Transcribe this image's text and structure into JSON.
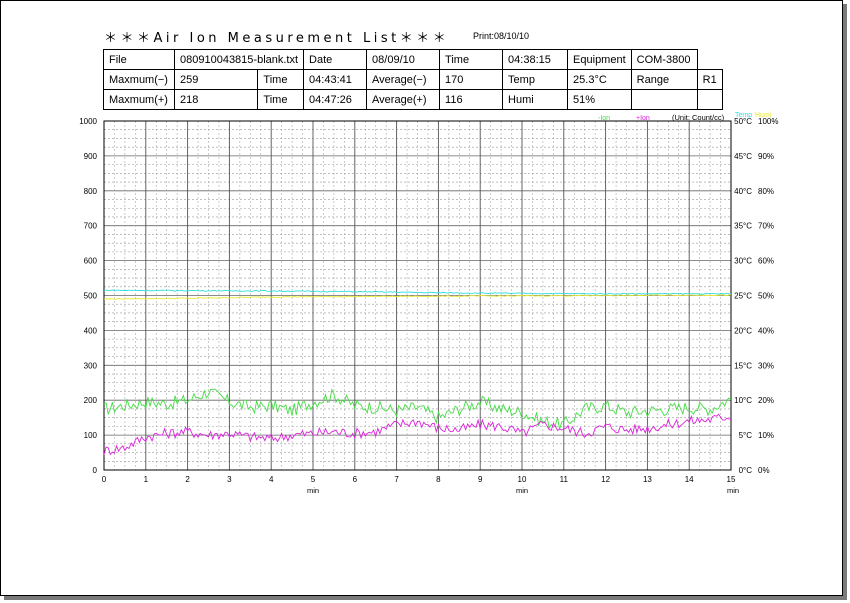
{
  "header": {
    "title": "＊＊＊Air Ion Measurement List＊＊＊",
    "print": "Print:08/10/10"
  },
  "info_table": [
    [
      "File",
      "080910043815-blank.txt",
      "Date",
      "08/09/10",
      "Time",
      "04:38:15",
      "Equipment",
      "COM-3800"
    ],
    [
      "Maxmum(−)",
      "259",
      "Time",
      "04:43:41",
      "Average(−)",
      "170",
      "Temp",
      "25.3°C",
      "Range",
      "R1"
    ],
    [
      "Maxmum(+)",
      "218",
      "Time",
      "04:47:26",
      "Average(+)",
      "116",
      "Humi",
      "51%"
    ]
  ],
  "chart_data": {
    "type": "line",
    "unit_label": "(Unit: Count/cc)",
    "legend": {
      "neg_ion": "-Ion",
      "pos_ion": "+Ion",
      "temp": "Temp",
      "humi": "Humi"
    },
    "x_ticks": [
      "0",
      "1",
      "2",
      "3",
      "4",
      "5",
      "6",
      "7",
      "8",
      "9",
      "10",
      "11",
      "12",
      "13",
      "14",
      "15"
    ],
    "x_unit_labels": [
      "min",
      "min",
      "min"
    ],
    "y_left_ticks": [
      "0",
      "100",
      "200",
      "300",
      "400",
      "500",
      "600",
      "700",
      "800",
      "900",
      "1000"
    ],
    "y_right_temp_ticks": [
      "0°C",
      "5°C",
      "10°C",
      "15°C",
      "20°C",
      "25°C",
      "30°C",
      "35°C",
      "40°C",
      "45°C",
      "50°C"
    ],
    "y_right_humi_ticks": [
      "0%",
      "10%",
      "20%",
      "30%",
      "40%",
      "50%",
      "60%",
      "70%",
      "80%",
      "90%",
      "100%"
    ],
    "xlim": [
      0,
      15
    ],
    "ylim": [
      0,
      1000
    ],
    "colors": {
      "neg_ion": "#44dd44",
      "pos_ion": "#dd22dd",
      "temp": "#e8e830",
      "humi": "#33dddd"
    },
    "series": [
      {
        "name": "-Ion",
        "x": [
          0,
          0.5,
          1,
          1.5,
          2,
          2.5,
          3,
          3.5,
          4,
          4.5,
          5,
          5.5,
          6,
          6.5,
          7,
          7.5,
          8,
          8.5,
          9,
          9.5,
          10,
          10.5,
          11,
          11.5,
          12,
          12.5,
          13,
          13.5,
          14,
          14.5,
          15
        ],
        "values": [
          175,
          185,
          195,
          190,
          200,
          225,
          195,
          180,
          185,
          170,
          195,
          215,
          185,
          180,
          170,
          180,
          150,
          175,
          195,
          175,
          165,
          140,
          130,
          175,
          185,
          165,
          170,
          175,
          180,
          175,
          205
        ]
      },
      {
        "name": "+Ion",
        "x": [
          0,
          0.5,
          1,
          1.5,
          2,
          2.5,
          3,
          3.5,
          4,
          4.5,
          5,
          5.5,
          6,
          6.5,
          7,
          7.5,
          8,
          8.5,
          9,
          9.5,
          10,
          10.5,
          11,
          11.5,
          12,
          12.5,
          13,
          13.5,
          14,
          14.5,
          15
        ],
        "values": [
          55,
          65,
          95,
          105,
          110,
          100,
          105,
          95,
          90,
          100,
          105,
          110,
          105,
          110,
          130,
          140,
          120,
          115,
          130,
          125,
          105,
          130,
          120,
          105,
          125,
          115,
          120,
          130,
          140,
          145,
          155
        ]
      },
      {
        "name": "Temp",
        "x": [
          0,
          2,
          4,
          6,
          8,
          10,
          12,
          14,
          15
        ],
        "values": [
          490,
          492,
          496,
          497,
          498,
          499,
          500,
          501,
          501
        ]
      },
      {
        "name": "Humi",
        "x": [
          0,
          2,
          4,
          6,
          8,
          10,
          12,
          14,
          15
        ],
        "values": [
          515,
          514,
          513,
          511,
          508,
          506,
          505,
          505,
          505
        ]
      }
    ]
  }
}
